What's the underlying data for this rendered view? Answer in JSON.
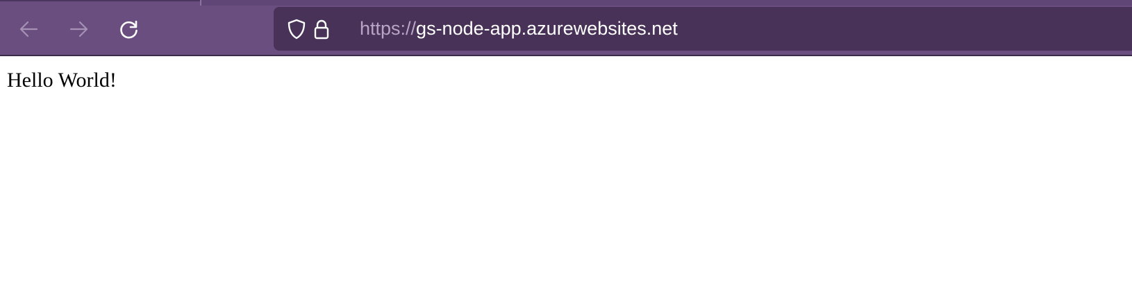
{
  "browser": {
    "back_icon": "arrow-left-icon",
    "forward_icon": "arrow-right-icon",
    "reload_icon": "reload-icon",
    "shield_icon": "shield-icon",
    "lock_icon": "lock-icon",
    "url_scheme": "https://",
    "url_host": "gs-node-app.azurewebsites.net",
    "colors": {
      "toolbar": "#6a4e80",
      "urlbar": "#483257",
      "scheme_text": "#b7a6c6",
      "host_text": "#ffffff"
    }
  },
  "page": {
    "text": "Hello World!"
  }
}
